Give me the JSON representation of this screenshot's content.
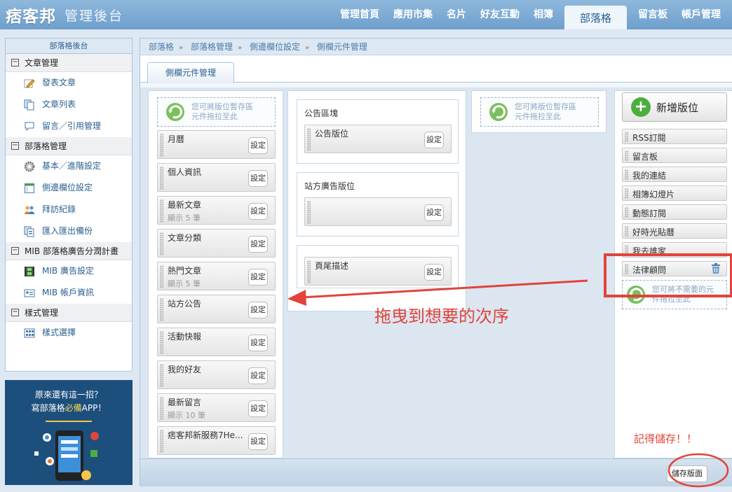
{
  "header": {
    "brand": "痞客邦",
    "subtitle": "管理後台",
    "nav": [
      {
        "label": "管理首頁",
        "active": false
      },
      {
        "label": "應用市集",
        "active": false
      },
      {
        "label": "名片",
        "active": false
      },
      {
        "label": "好友互動",
        "active": false
      },
      {
        "label": "相簿",
        "active": false
      },
      {
        "label": "部落格",
        "active": true
      },
      {
        "label": "留言板",
        "active": false
      },
      {
        "label": "帳戶管理",
        "active": false
      }
    ]
  },
  "sidebar": {
    "title": "部落格後台",
    "sections": [
      {
        "label": "文章管理",
        "items": [
          {
            "label": "發表文章",
            "icon": "pencil-icon"
          },
          {
            "label": "文章列表",
            "icon": "document-list-icon"
          },
          {
            "label": "留言／引用管理",
            "icon": "speech-bubble-icon"
          }
        ]
      },
      {
        "label": "部落格管理",
        "items": [
          {
            "label": "基本／進階設定",
            "icon": "gear-icon"
          },
          {
            "label": "側邊欄位設定",
            "icon": "layout-icon"
          },
          {
            "label": "拜訪紀錄",
            "icon": "users-icon"
          },
          {
            "label": "匯入匯出備份",
            "icon": "backup-icon"
          }
        ]
      },
      {
        "label": "MIB 部落格廣告分潤計畫",
        "items": [
          {
            "label": "MIB 廣告設定",
            "icon": "film-icon"
          },
          {
            "label": "MIB 帳戶資訊",
            "icon": "id-card-icon"
          }
        ]
      },
      {
        "label": "樣式管理",
        "items": [
          {
            "label": "樣式選擇",
            "icon": "grid-icon"
          }
        ]
      }
    ]
  },
  "promo": {
    "line1": "原來還有這一招？",
    "line2_pre": "寫部落格",
    "line2_hl": "必備",
    "line2_post": "APP！"
  },
  "breadcrumb": [
    "部落格",
    "部落格管理",
    "側邊欄位設定",
    "側欄元件管理"
  ],
  "tab": "側欄元件管理",
  "dropzone_text": {
    "line1": "您可將版位暫存區",
    "line2": "元件拖拉至此"
  },
  "trash_text": {
    "line1": "您可將不需要的元",
    "line2": "件拖拉至此"
  },
  "column1_widgets": [
    {
      "name": "月曆",
      "sub": ""
    },
    {
      "name": "個人資訊",
      "sub": ""
    },
    {
      "name": "最新文章",
      "sub": "顯示 5 筆"
    },
    {
      "name": "文章分類",
      "sub": ""
    },
    {
      "name": "熱門文章",
      "sub": "顯示 5 筆"
    },
    {
      "name": "站方公告",
      "sub": ""
    },
    {
      "name": "活動快報",
      "sub": ""
    },
    {
      "name": "我的好友",
      "sub": ""
    },
    {
      "name": "最新留言",
      "sub": "顯示 10 筆"
    },
    {
      "name": "痞客邦新服務7He...",
      "sub": ""
    }
  ],
  "setting_label": "設定",
  "zones": [
    {
      "title": "公告區塊",
      "widget": "公告版位"
    },
    {
      "title": "站方廣告版位",
      "widget": ""
    },
    {
      "title": "",
      "widget": "頁尾描述"
    }
  ],
  "add_button": "新增版位",
  "available_widgets": [
    "RSS訂閱",
    "留言板",
    "我的連結",
    "相簿幻燈片",
    "動態訂閱",
    "好時光貼曆",
    "我去誰家",
    "法律顧問"
  ],
  "save_button": "儲存版面",
  "annotations": {
    "drag_hint": "拖曳到想要的次序",
    "save_hint": "記得儲存！！"
  },
  "colors": {
    "accent": "#6e9fcc",
    "annotation": "#e2433a",
    "add": "#4cae3f"
  }
}
